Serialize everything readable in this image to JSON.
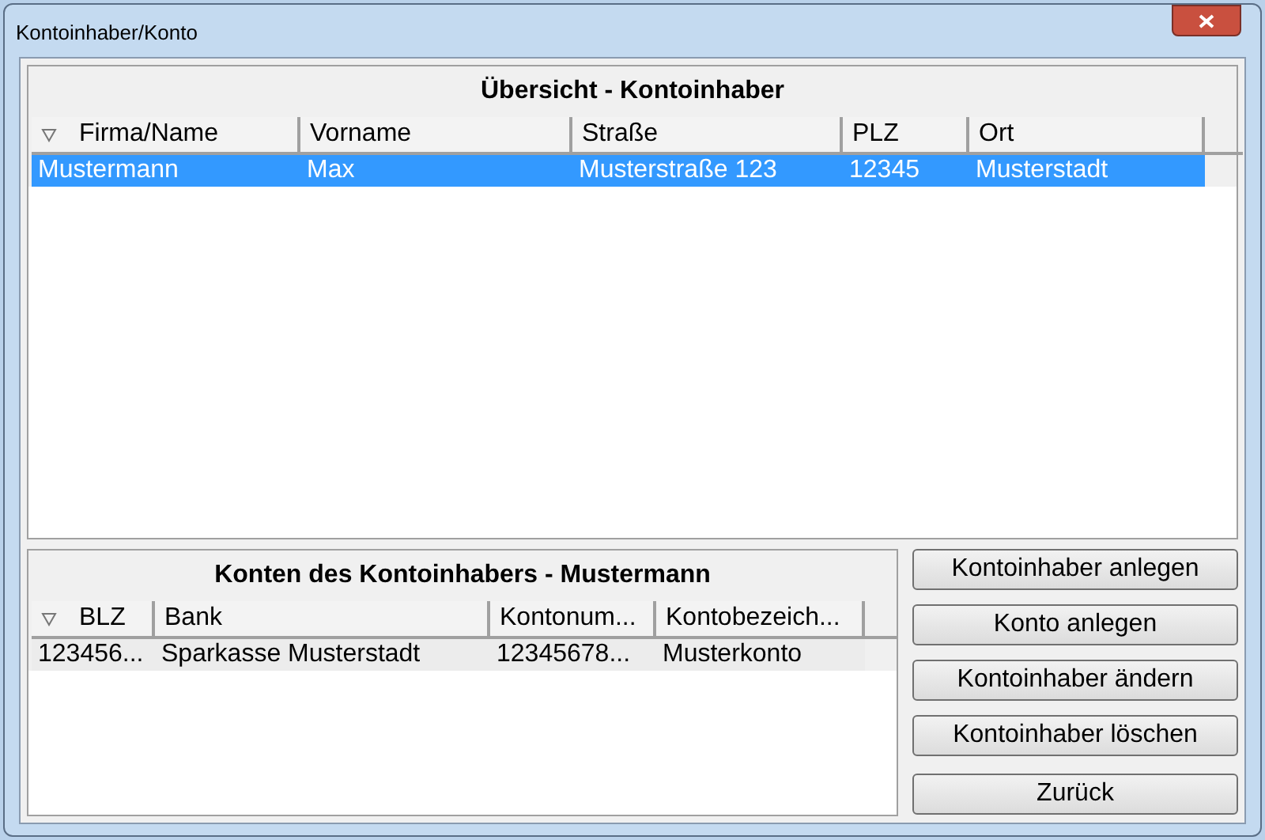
{
  "window": {
    "title": "Kontoinhaber/Konto"
  },
  "owners": {
    "title": "Übersicht - Kontoinhaber",
    "active": true,
    "columns": [
      {
        "label": "Firma/Name",
        "sorted": true
      },
      {
        "label": "Vorname",
        "sorted": false
      },
      {
        "label": "Straße",
        "sorted": false
      },
      {
        "label": "PLZ",
        "sorted": false
      },
      {
        "label": "Ort",
        "sorted": false
      }
    ],
    "rows": [
      {
        "cells": [
          "Mustermann",
          "Max",
          "Musterstraße 123",
          "12345",
          "Musterstadt"
        ],
        "selected": true
      }
    ]
  },
  "accounts": {
    "title": "Konten des Kontoinhabers - Mustermann",
    "active": false,
    "columns": [
      {
        "label": "BLZ",
        "sorted": true
      },
      {
        "label": "Bank",
        "sorted": false
      },
      {
        "label": "Kontonum...",
        "sorted": false
      },
      {
        "label": "Kontobezeich...",
        "sorted": false
      }
    ],
    "rows": [
      {
        "cells": [
          "123456...",
          "Sparkasse Musterstadt",
          "12345678...",
          "Musterkonto"
        ],
        "selected": true
      }
    ]
  },
  "buttons": [
    "Kontoinhaber anlegen",
    "Konto anlegen",
    "Kontoinhaber ändern",
    "Kontoinhaber löschen",
    "Zurück"
  ]
}
